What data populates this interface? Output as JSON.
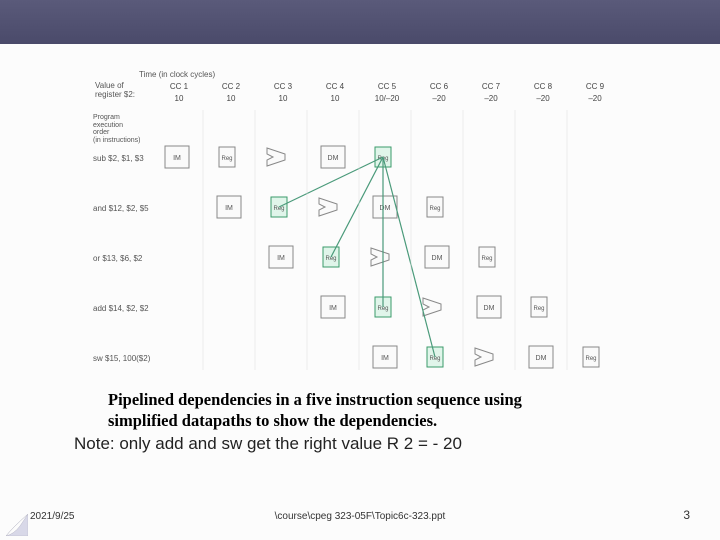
{
  "header": {},
  "diagram": {
    "time_label": "Time (in clock cycles)",
    "valreg_label_line1": "Value of",
    "valreg_label_line2": "register $2:",
    "prog_label_line1": "Program",
    "prog_label_line2": "execution",
    "prog_label_line3": "order",
    "prog_label_line4": "(in instructions)",
    "cc_headers": [
      "CC 1",
      "CC 2",
      "CC 3",
      "CC 4",
      "CC 5",
      "CC 6",
      "CC 7",
      "CC 8",
      "CC 9"
    ],
    "cc_values": [
      "10",
      "10",
      "10",
      "10",
      "10/–20",
      "–20",
      "–20",
      "–20",
      "–20"
    ],
    "instructions": [
      "sub $2, $1, $3",
      "and $12, $2, $5",
      "or $13, $6, $2",
      "add $14, $2, $2",
      "sw $15, 100($2)"
    ],
    "stage_labels": {
      "im": "IM",
      "reg": "Reg",
      "dm": "DM"
    }
  },
  "caption": {
    "line1": "Pipelined dependencies in a five instruction sequence using",
    "line2": "simplified datapaths to show the dependencies."
  },
  "note": "Note: only add and sw get the right value R 2 = - 20",
  "footer": {
    "date": "2021/9/25",
    "path": "\\course\\cpeg 323-05F\\Topic6c-323.ppt",
    "page": "3"
  }
}
